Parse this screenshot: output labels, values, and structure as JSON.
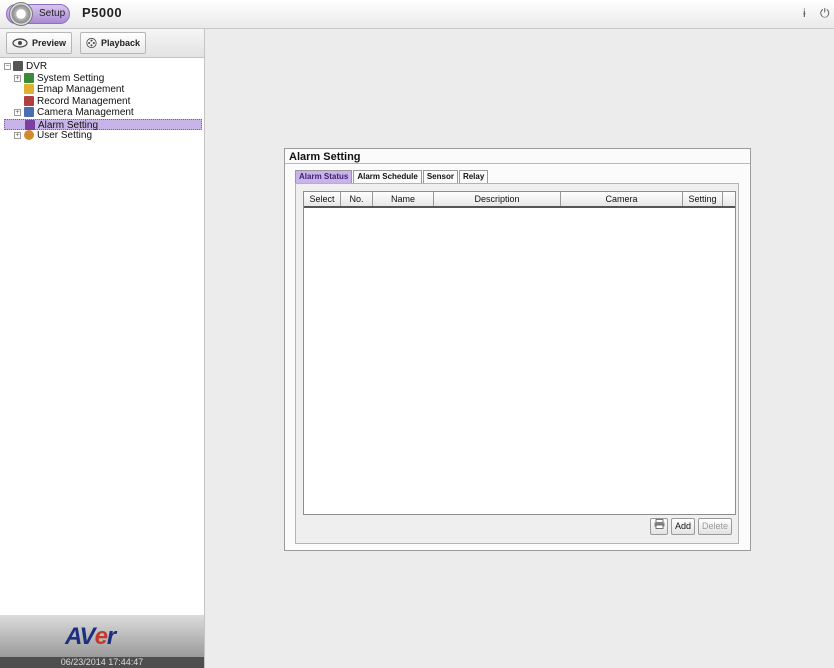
{
  "topbar": {
    "setup_label": "Setup",
    "model": "P5000",
    "icons": [
      "info-icon",
      "power-icon"
    ]
  },
  "modes": {
    "preview_label": "Preview",
    "playback_label": "Playback"
  },
  "tree": {
    "root": "DVR",
    "items": [
      {
        "label": "System Setting"
      },
      {
        "label": "Emap Management"
      },
      {
        "label": "Record Management"
      },
      {
        "label": "Camera Management"
      },
      {
        "label": "Alarm Setting",
        "selected": true
      },
      {
        "label": "User Setting"
      }
    ]
  },
  "brand": {
    "logo_prefix": "AV",
    "logo_mid": "e",
    "logo_suffix": "r"
  },
  "datetime": "06/23/2014 17:44:47",
  "panel": {
    "title": "Alarm Setting",
    "tabs": [
      "Alarm Status",
      "Alarm Schedule",
      "Sensor",
      "Relay"
    ],
    "active_tab": "Alarm Status",
    "columns": [
      "Select",
      "No.",
      "Name",
      "Description",
      "Camera",
      "Setting"
    ],
    "rows": [],
    "add_label": "Add",
    "delete_label": "Delete"
  },
  "colors": {
    "accent": "#c8b4e8",
    "brand_blue": "#1c2f80"
  }
}
